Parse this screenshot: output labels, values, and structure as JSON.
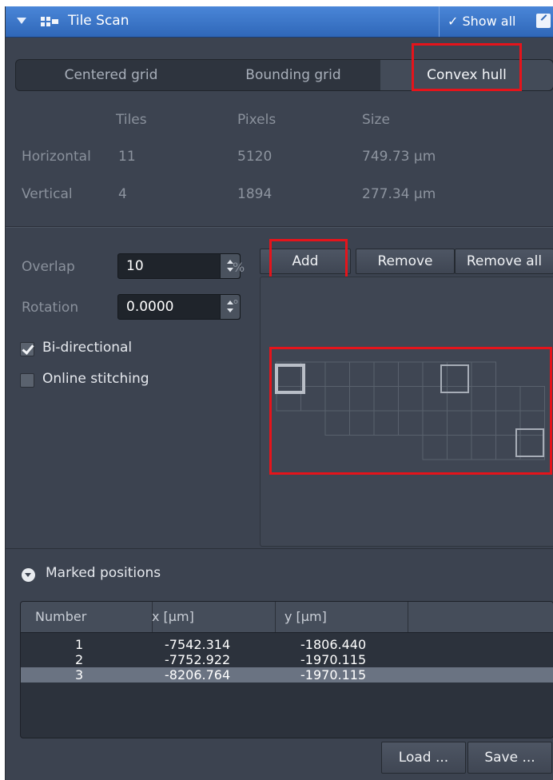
{
  "panel": {
    "title": "Tile Scan",
    "show_all": "Show all",
    "check_glyph": "✓"
  },
  "tabs": [
    {
      "label": "Centered grid",
      "active": false
    },
    {
      "label": "Bounding grid",
      "active": false
    },
    {
      "label": "Convex hull",
      "active": true
    }
  ],
  "dimensions": {
    "headers": [
      "Tiles",
      "Pixels",
      "Size"
    ],
    "rows": [
      {
        "label": "Horizontal",
        "tiles": "11",
        "pixels": "5120",
        "size": "749.73 µm"
      },
      {
        "label": "Vertical",
        "tiles": "4",
        "pixels": "1894",
        "size": "277.34 µm"
      }
    ]
  },
  "overlap": {
    "label": "Overlap",
    "value": "10",
    "unit": "%"
  },
  "rotation": {
    "label": "Rotation",
    "value": "0.0000",
    "unit": "°"
  },
  "options": [
    {
      "label": "Bi-directional",
      "checked": true
    },
    {
      "label": "Online stitching",
      "checked": false
    }
  ],
  "buttons": {
    "add": "Add",
    "remove": "Remove",
    "remove_all": "Remove all",
    "load": "Load ...",
    "save": "Save ..."
  },
  "marked_positions": {
    "label": "Marked positions",
    "columns": [
      "Number",
      "x [µm]",
      "y [µm]"
    ],
    "rows": [
      {
        "number": "1",
        "x": "-7542.314",
        "y": "-1806.440",
        "selected": false
      },
      {
        "number": "2",
        "x": "-7752.922",
        "y": "-1970.115",
        "selected": false
      },
      {
        "number": "3",
        "x": "-8206.764",
        "y": "-1970.115",
        "selected": true
      }
    ]
  },
  "colors": {
    "accent": "#2f67b8",
    "panel": "#3c4350",
    "highlight": "#e5141b"
  }
}
